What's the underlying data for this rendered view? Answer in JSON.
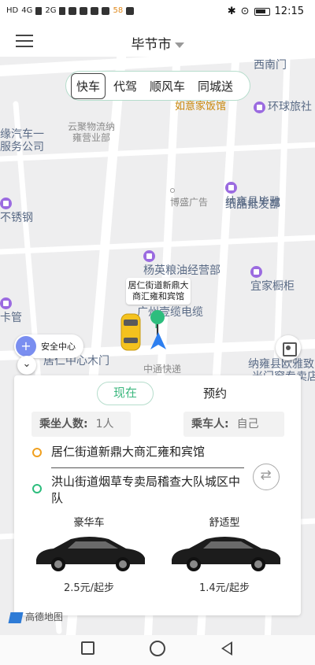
{
  "status_bar": {
    "left_tags": [
      "HD",
      "4G",
      "2G"
    ],
    "badge": "58",
    "time": "12:15"
  },
  "header": {
    "city": "毕节市"
  },
  "service_tabs": [
    {
      "label": "快车",
      "active": true
    },
    {
      "label": "代驾",
      "active": false
    },
    {
      "label": "顺风车",
      "active": false
    },
    {
      "label": "同城送",
      "active": false
    }
  ],
  "map": {
    "pois": {
      "p1": "云聚物流纳",
      "p1b": "雍营业部",
      "p2": "如意家饭馆",
      "p3": "环球旅社",
      "p4": "西南门",
      "p5": "缘汽车一",
      "p5b": "服务公司",
      "p6": "博盛广告",
      "p7": "纳雍县毕雅",
      "p7b": "纸品批发部",
      "p8": "不锈钢",
      "p9": "杨英粮油经营部",
      "p10": "宜家橱柜",
      "p11": "广州壹缆电缆",
      "p12": "卡管",
      "p13": "居仁中心木门",
      "p14": "中通快递",
      "p15": "纳雍县欧雅致",
      "p15b": "米门窗专卖店"
    },
    "pickup_label": "居仁街道新鼎大商汇雍和宾馆",
    "safety_center": "安全中心"
  },
  "booking": {
    "tab_now": "现在",
    "tab_later": "预约",
    "passenger_count_label": "乘坐人数:",
    "passenger_count_value": "1人",
    "rider_label": "乘车人:",
    "rider_value": "自己",
    "from": "居仁街道新鼎大商汇雍和宾馆",
    "to": "洪山街道烟草专卖局稽查大队城区中队",
    "options": [
      {
        "name": "豪华车",
        "price": "2.5元/起步"
      },
      {
        "name": "舒适型",
        "price": "1.4元/起步"
      }
    ]
  },
  "map_logo": "高德地图",
  "colors": {
    "accent_green": "#3bb77e",
    "origin_orange": "#f0a020",
    "dest_green": "#2dbd7d"
  }
}
